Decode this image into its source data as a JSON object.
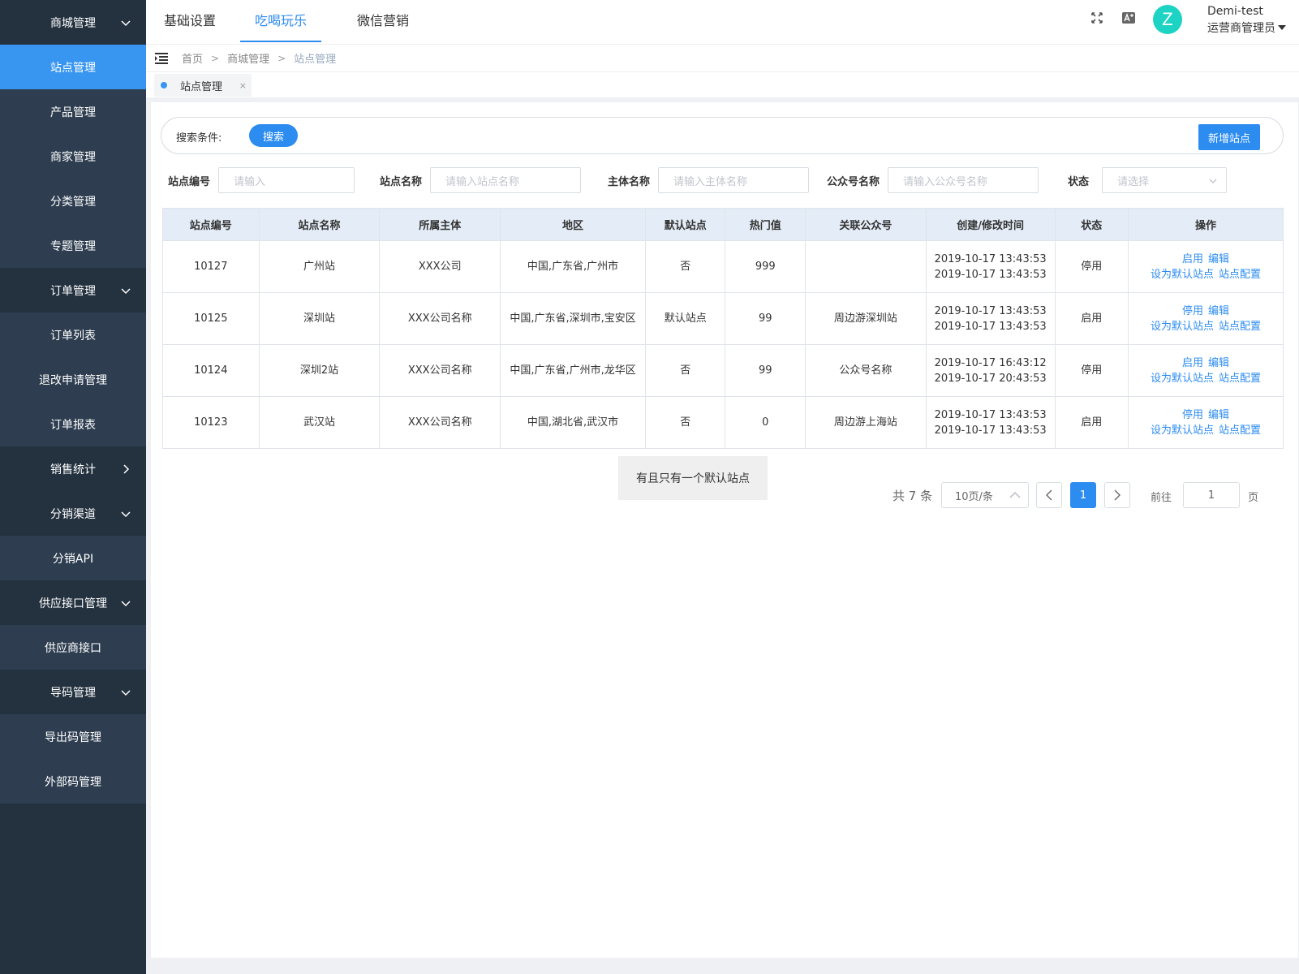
{
  "sidebar": {
    "items": [
      {
        "label": "商城管理",
        "kind": "group",
        "chevron": "down"
      },
      {
        "label": "站点管理",
        "kind": "active",
        "chevron": ""
      },
      {
        "label": "产品管理",
        "kind": "sub",
        "chevron": ""
      },
      {
        "label": "商家管理",
        "kind": "sub",
        "chevron": ""
      },
      {
        "label": "分类管理",
        "kind": "sub",
        "chevron": ""
      },
      {
        "label": "专题管理",
        "kind": "sub",
        "chevron": ""
      },
      {
        "label": "订单管理",
        "kind": "group",
        "chevron": "down"
      },
      {
        "label": "订单列表",
        "kind": "sub",
        "chevron": ""
      },
      {
        "label": "退改申请管理",
        "kind": "sub",
        "chevron": ""
      },
      {
        "label": "订单报表",
        "kind": "sub",
        "chevron": ""
      },
      {
        "label": "销售统计",
        "kind": "group",
        "chevron": "right"
      },
      {
        "label": "分销渠道",
        "kind": "group",
        "chevron": "down"
      },
      {
        "label": "分销API",
        "kind": "sub",
        "chevron": ""
      },
      {
        "label": "供应接口管理",
        "kind": "group",
        "chevron": "down"
      },
      {
        "label": "供应商接口",
        "kind": "sub",
        "chevron": ""
      },
      {
        "label": "导码管理",
        "kind": "group",
        "chevron": "down"
      },
      {
        "label": "导出码管理",
        "kind": "sub",
        "chevron": ""
      },
      {
        "label": "外部码管理",
        "kind": "sub",
        "chevron": ""
      }
    ]
  },
  "topbar": {
    "tabs": [
      "基础设置",
      "吃喝玩乐",
      "微信营销"
    ],
    "active_tab": 1,
    "avatar_letter": "Z",
    "user_name": "Demi-test",
    "user_role": "运营商管理员"
  },
  "breadcrumb": {
    "home": "首页",
    "section": "商城管理",
    "current": "站点管理"
  },
  "page_tab": {
    "label": "站点管理",
    "close": "×"
  },
  "search": {
    "label": "搜索条件:",
    "button": "搜索",
    "add_button": "新增站点"
  },
  "filters": {
    "site_no_label": "站点编号",
    "site_no_placeholder": "请输入",
    "site_name_label": "站点名称",
    "site_name_placeholder": "请输入站点名称",
    "entity_label": "主体名称",
    "entity_placeholder": "请输入主体名称",
    "account_label": "公众号名称",
    "account_placeholder": "请输入公众号名称",
    "status_label": "状态",
    "status_placeholder": "请选择"
  },
  "table": {
    "headers": [
      "站点编号",
      "站点名称",
      "所属主体",
      "地区",
      "默认站点",
      "热门值",
      "关联公众号",
      "创建/修改时间",
      "状态",
      "操作"
    ],
    "rows": [
      {
        "id": "10127",
        "name": "广州站",
        "entity": "XXX公司",
        "region": "中国,广东省,广州市",
        "default": "否",
        "hot": "999",
        "account": "",
        "created": "2019-10-17 13:43:53",
        "modified": "2019-10-17 13:43:53",
        "status": "停用",
        "status_off": true,
        "toggle": "启用",
        "edit": "编辑",
        "set_default": "设为默认站点",
        "config": "站点配置"
      },
      {
        "id": "10125",
        "name": "深圳站",
        "entity": "XXX公司名称",
        "region": "中国,广东省,深圳市,宝安区",
        "default": "默认站点",
        "hot": "99",
        "account": "周边游深圳站",
        "created": "2019-10-17 13:43:53",
        "modified": "2019-10-17 13:43:53",
        "status": "启用",
        "status_off": false,
        "toggle": "停用",
        "edit": "编辑",
        "set_default": "设为默认站点",
        "config": "站点配置"
      },
      {
        "id": "10124",
        "name": "深圳2站",
        "entity": "XXX公司名称",
        "region": "中国,广东省,广州市,龙华区",
        "default": "否",
        "hot": "99",
        "account": "公众号名称",
        "created": "2019-10-17 16:43:12",
        "modified": "2019-10-17 20:43:53",
        "status": "停用",
        "status_off": true,
        "toggle": "启用",
        "edit": "编辑",
        "set_default": "设为默认站点",
        "config": "站点配置"
      },
      {
        "id": "10123",
        "name": "武汉站",
        "entity": "XXX公司名称",
        "region": "中国,湖北省,武汉市",
        "default": "否",
        "hot": "0",
        "account": "周边游上海站",
        "created": "2019-10-17 13:43:53",
        "modified": "2019-10-17 13:43:53",
        "status": "启用",
        "status_off": false,
        "toggle": "停用",
        "edit": "编辑",
        "set_default": "设为默认站点",
        "config": "站点配置"
      }
    ]
  },
  "notice": "有且只有一个默认站点",
  "pagination": {
    "total": "共 7 条",
    "page_size": "10页/条",
    "current_page": "1",
    "goto_label": "前往",
    "goto_value": "1",
    "page_suffix": "页"
  },
  "colors": {
    "sidebar_bg": "#243240",
    "sidebar_sub_bg": "#2e3e50",
    "accent": "#2d8cf0",
    "status_off": "#e01010",
    "avatar": "#1dd3c4"
  }
}
